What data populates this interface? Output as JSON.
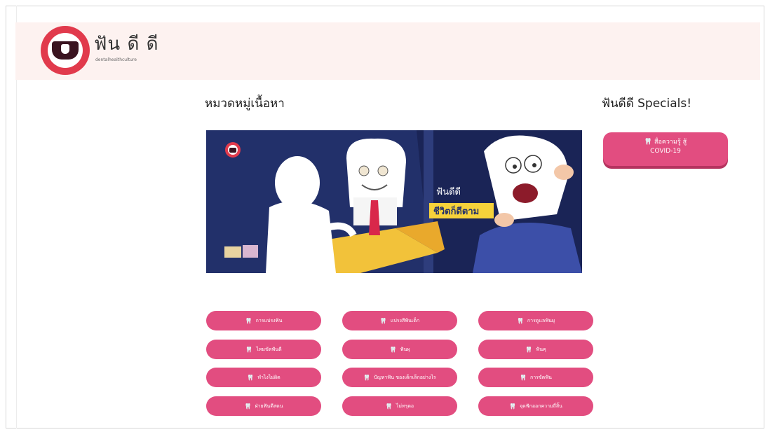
{
  "header": {
    "logo_text": "ฟัน ดี ดี",
    "logo_sub": "dentalhealthculture"
  },
  "main": {
    "section_title": "หมวดหมู่เนื้อหา",
    "banner": {
      "brand": "ฟัน ดี ดี",
      "slogan_line1": "ฟันดีดี",
      "slogan_line2": "ชีวิตก็ดีตาม"
    },
    "categories": [
      "การแปรงฟัน",
      "แปรงสีฟันเด็ก",
      "การดูแลฟันผุ",
      "ไหมขัดฟันดี",
      "ฟันผุ",
      "ฟันคุ",
      "ทำไงไม่ผิด",
      "ปัญหาฟัน ของเด็กเล็กอย่างไร",
      "การขัดฟัน",
      "ฝ่ายฟันดีสดน",
      "ไม่ทรุดอ",
      "จุดฟักออกความถี่สิ้น"
    ]
  },
  "specials": {
    "title": "ฟันดีดี Specials!",
    "button_line1": "สื่อความรู้ สู้",
    "button_line2": "COVID-19"
  },
  "colors": {
    "accent": "#e24d80",
    "header_bg": "#fdf2f0",
    "logo_red": "#e13a4c",
    "banner_navy": "#1f2a5e"
  }
}
